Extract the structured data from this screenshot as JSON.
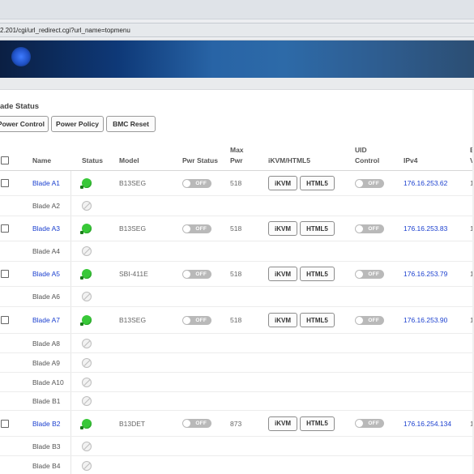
{
  "browser": {
    "address": "2.201/cgi/url_redirect.cgi?url_name=topmenu"
  },
  "section": {
    "title": "ade Status"
  },
  "toolbar": {
    "power_control": "Power Control",
    "power_policy": "Power Policy",
    "bmc_reset": "BMC Reset"
  },
  "table": {
    "headers": {
      "name": "Name",
      "status": "Status",
      "model": "Model",
      "pwr_status": "Pwr Status",
      "max_pwr_line1": "Max",
      "max_pwr_line2": "Pwr",
      "ikvm": "iKVM/HTML5",
      "uid_line1": "UID",
      "uid_line2": "Control",
      "ipv4": "IPv4",
      "cut_line1": "B",
      "cut_line2": "V"
    },
    "toggle_off_label": "OFF",
    "ikvm_label": "iKVM",
    "html5_label": "HTML5",
    "rows": [
      {
        "name": "Blade A1",
        "present": true,
        "model": "B13SEG",
        "max_pwr": "518",
        "ipv4": "176.16.253.62",
        "cut": "1"
      },
      {
        "name": "Blade A2",
        "present": false
      },
      {
        "name": "Blade A3",
        "present": true,
        "model": "B13SEG",
        "max_pwr": "518",
        "ipv4": "176.16.253.83",
        "cut": "1"
      },
      {
        "name": "Blade A4",
        "present": false
      },
      {
        "name": "Blade A5",
        "present": true,
        "model": "SBI-411E",
        "max_pwr": "518",
        "ipv4": "176.16.253.79",
        "cut": "1"
      },
      {
        "name": "Blade A6",
        "present": false
      },
      {
        "name": "Blade A7",
        "present": true,
        "model": "B13SEG",
        "max_pwr": "518",
        "ipv4": "176.16.253.90",
        "cut": "1"
      },
      {
        "name": "Blade A8",
        "present": false
      },
      {
        "name": "Blade A9",
        "present": false
      },
      {
        "name": "Blade A10",
        "present": false
      },
      {
        "name": "Blade B1",
        "present": false
      },
      {
        "name": "Blade B2",
        "present": true,
        "model": "B13DET",
        "max_pwr": "873",
        "ipv4": "176.16.254.134",
        "cut": "1"
      },
      {
        "name": "Blade B3",
        "present": false
      },
      {
        "name": "Blade B4",
        "present": false
      }
    ]
  },
  "colors": {
    "link": "#1a3fcf",
    "status_on": "#38c838",
    "toggle_off": "#b9b9b9"
  }
}
